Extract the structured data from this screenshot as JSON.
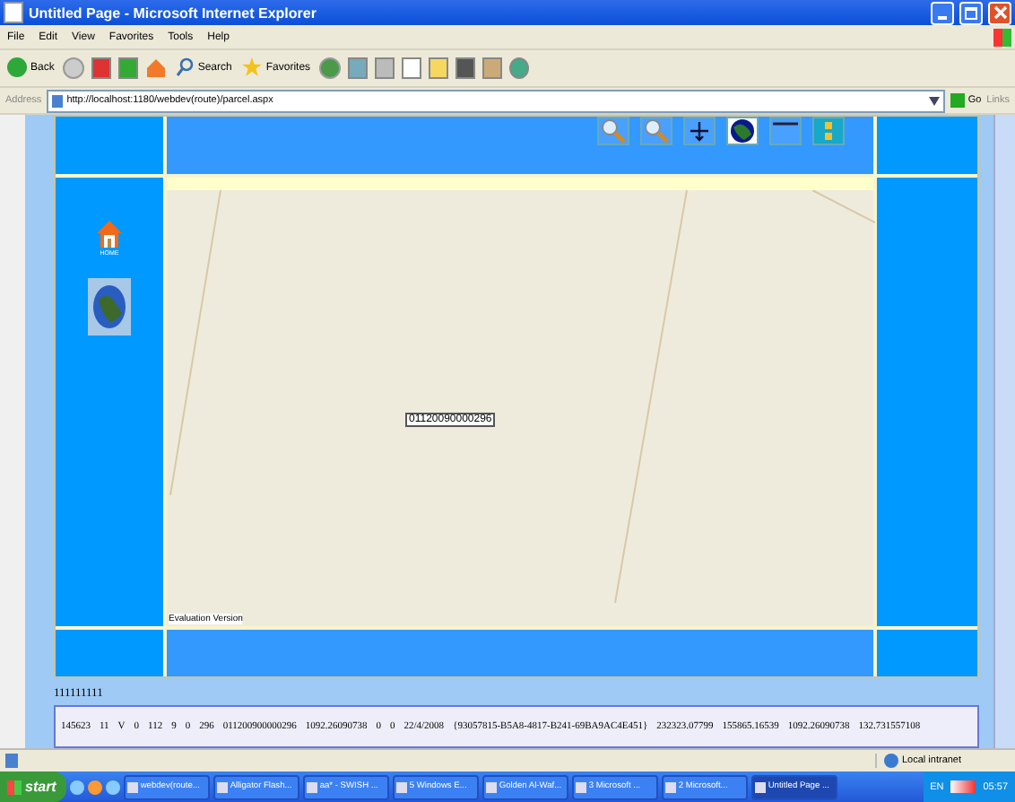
{
  "window": {
    "title": "Untitled Page - Microsoft Internet Explorer"
  },
  "menu": [
    "File",
    "Edit",
    "View",
    "Favorites",
    "Tools",
    "Help"
  ],
  "toolbar": {
    "back": "Back",
    "search": "Search",
    "favorites": "Favorites"
  },
  "address": {
    "label": "Address",
    "url": "http://localhost:1180/webdev(route)/parcel.aspx",
    "go": "Go",
    "links": "Links"
  },
  "page": {
    "home_label": "HOME",
    "map_label": "01120090000296",
    "evaluation_label": "Evaluation Version"
  },
  "record": {
    "id": "111111111",
    "cells": [
      "145623",
      "11",
      "V",
      "0",
      "112",
      "9",
      "0",
      "296",
      "011200900000296",
      "1092.26090738",
      "0",
      "0",
      "22/4/2008",
      "{93057815-B5A8-4817-B241-69BA9AC4E451}",
      "232323.07799",
      "155865.16539",
      "1092.26090738",
      "132.731557108"
    ]
  },
  "status_bar": {
    "zone": "Local intranet"
  },
  "taskbar": {
    "start": "start",
    "items": [
      {
        "label": "webdev(route...",
        "selected": false
      },
      {
        "label": "Alligator Flash...",
        "selected": false
      },
      {
        "label": "aa* - SWISH ...",
        "selected": false
      },
      {
        "label": "5 Windows E...",
        "selected": false
      },
      {
        "label": "Golden Al-Waf...",
        "selected": false
      },
      {
        "label": "3 Microsoft ...",
        "selected": false
      },
      {
        "label": "2 Microsoft...",
        "selected": false
      },
      {
        "label": "Untitled Page ...",
        "selected": true
      }
    ],
    "language": "EN",
    "clock": "05:57"
  }
}
